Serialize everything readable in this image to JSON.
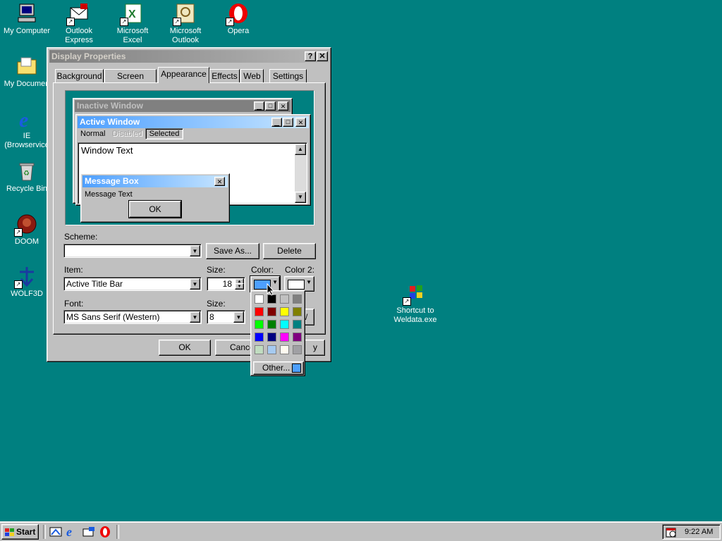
{
  "desktop": {
    "icons": [
      {
        "label1": "My Computer",
        "label2": ""
      },
      {
        "label1": "Outlook",
        "label2": "Express"
      },
      {
        "label1": "Microsoft",
        "label2": "Excel"
      },
      {
        "label1": "Microsoft",
        "label2": "Outlook"
      },
      {
        "label1": "Opera",
        "label2": ""
      },
      {
        "label1": "My Documen",
        "label2": ""
      },
      {
        "label1": "IE",
        "label2": "(Browservice"
      },
      {
        "label1": "Recycle Bin",
        "label2": ""
      },
      {
        "label1": "DOOM",
        "label2": ""
      },
      {
        "label1": "WOLF3D",
        "label2": ""
      },
      {
        "label1": "Shortcut to",
        "label2": "Weldata.exe"
      }
    ]
  },
  "dialog": {
    "title": "Display Properties",
    "help_btn": "?",
    "close_btn": "✕",
    "tabs": [
      "Background",
      "Screen Saver",
      "Appearance",
      "Effects",
      "Web",
      "Settings"
    ],
    "preview": {
      "inactive_title": "Inactive Window",
      "active_title": "Active Window",
      "menu_normal": "Normal",
      "menu_disabled": "Disabled",
      "menu_selected": "Selected",
      "window_text": "Window Text",
      "msgbox_title": "Message Box",
      "msgbox_text": "Message Text",
      "msgbox_ok": "OK"
    },
    "scheme_label": "Scheme:",
    "scheme_value": "",
    "save_as": "Save As...",
    "delete": "Delete",
    "item_label": "Item:",
    "item_value": "Active Title Bar",
    "size_label": "Size:",
    "size_value": "18",
    "color_label": "Color:",
    "color2_label": "Color 2:",
    "font_label": "Font:",
    "font_value": "MS Sans Serif (Western)",
    "font_size_label": "Size:",
    "font_size_value": "8",
    "ok": "OK",
    "cancel": "Cance",
    "apply": "y",
    "other": "Other..."
  },
  "colors": {
    "selected": "#4d9fff",
    "palette": [
      "#ffffff",
      "#000000",
      "#c0c0c0",
      "#808080",
      "#ff0000",
      "#800000",
      "#ffff00",
      "#808000",
      "#00ff00",
      "#008000",
      "#00ffff",
      "#008080",
      "#0000ff",
      "#000080",
      "#ff00ff",
      "#800080",
      "#c0dcc0",
      "#a6caf0",
      "#fffbf0",
      "#a0a0a4"
    ]
  },
  "taskbar": {
    "start": "Start",
    "clock": "9:22 AM"
  }
}
